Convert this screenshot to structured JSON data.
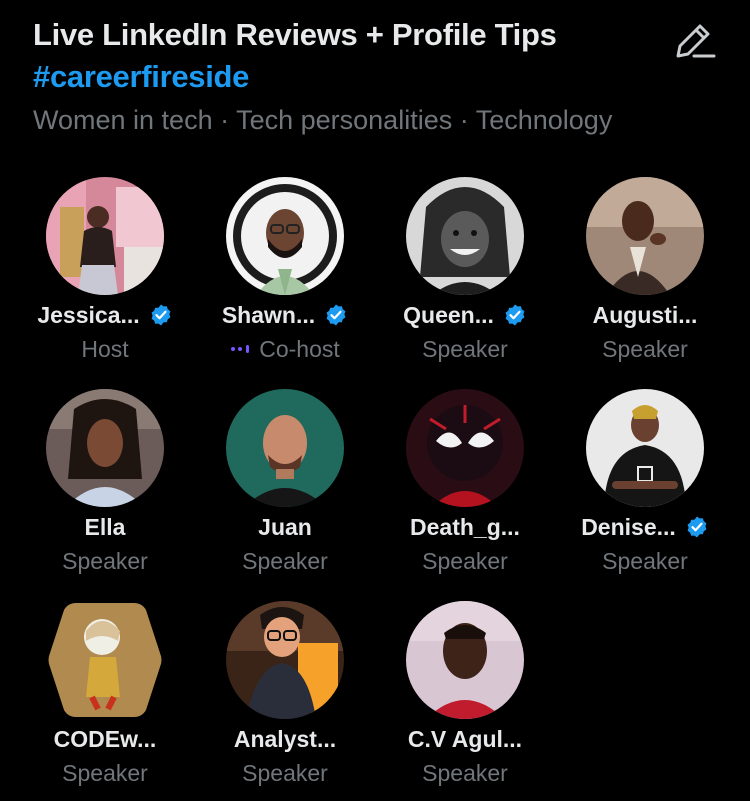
{
  "space": {
    "title": "Live LinkedIn Reviews + Profile Tips",
    "hashtag": "#careerfireside",
    "topics": "Women in tech · Tech personalities · Technology"
  },
  "colors": {
    "background": "#000000",
    "text": "#e7e9ea",
    "muted": "#71767b",
    "accent": "#1d9bf0",
    "speaking": "#7856ff"
  },
  "participants": [
    {
      "name": "Jessica...",
      "role": "Host",
      "verified": true,
      "speaking": false
    },
    {
      "name": "Shawn...",
      "role": "Co-host",
      "verified": true,
      "speaking": true
    },
    {
      "name": "Queen...",
      "role": "Speaker",
      "verified": true,
      "speaking": false
    },
    {
      "name": "Augusti...",
      "role": "Speaker",
      "verified": false,
      "speaking": false
    },
    {
      "name": "Ella",
      "role": "Speaker",
      "verified": false,
      "speaking": false
    },
    {
      "name": "Juan",
      "role": "Speaker",
      "verified": false,
      "speaking": false
    },
    {
      "name": "Death_g...",
      "role": "Speaker",
      "verified": false,
      "speaking": false
    },
    {
      "name": "Denise...",
      "role": "Speaker",
      "verified": true,
      "speaking": false
    },
    {
      "name": "CODEw...",
      "role": "Speaker",
      "verified": false,
      "speaking": false
    },
    {
      "name": "Analyst...",
      "role": "Speaker",
      "verified": false,
      "speaking": false
    },
    {
      "name": "C.V Agul...",
      "role": "Speaker",
      "verified": false,
      "speaking": false
    }
  ]
}
